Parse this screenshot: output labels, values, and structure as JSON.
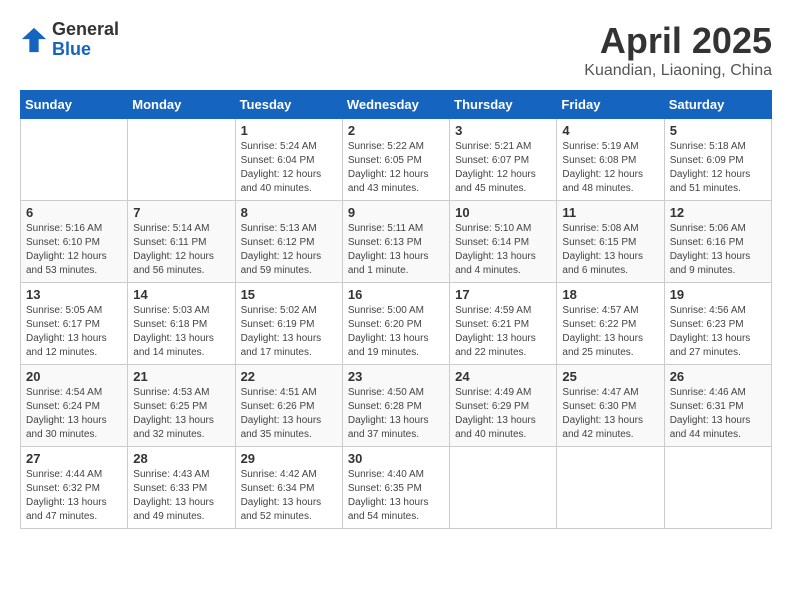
{
  "header": {
    "logo_general": "General",
    "logo_blue": "Blue",
    "month": "April 2025",
    "location": "Kuandian, Liaoning, China"
  },
  "weekdays": [
    "Sunday",
    "Monday",
    "Tuesday",
    "Wednesday",
    "Thursday",
    "Friday",
    "Saturday"
  ],
  "weeks": [
    [
      {
        "day": "",
        "sunrise": "",
        "sunset": "",
        "daylight": ""
      },
      {
        "day": "",
        "sunrise": "",
        "sunset": "",
        "daylight": ""
      },
      {
        "day": "1",
        "sunrise": "Sunrise: 5:24 AM",
        "sunset": "Sunset: 6:04 PM",
        "daylight": "Daylight: 12 hours and 40 minutes."
      },
      {
        "day": "2",
        "sunrise": "Sunrise: 5:22 AM",
        "sunset": "Sunset: 6:05 PM",
        "daylight": "Daylight: 12 hours and 43 minutes."
      },
      {
        "day": "3",
        "sunrise": "Sunrise: 5:21 AM",
        "sunset": "Sunset: 6:07 PM",
        "daylight": "Daylight: 12 hours and 45 minutes."
      },
      {
        "day": "4",
        "sunrise": "Sunrise: 5:19 AM",
        "sunset": "Sunset: 6:08 PM",
        "daylight": "Daylight: 12 hours and 48 minutes."
      },
      {
        "day": "5",
        "sunrise": "Sunrise: 5:18 AM",
        "sunset": "Sunset: 6:09 PM",
        "daylight": "Daylight: 12 hours and 51 minutes."
      }
    ],
    [
      {
        "day": "6",
        "sunrise": "Sunrise: 5:16 AM",
        "sunset": "Sunset: 6:10 PM",
        "daylight": "Daylight: 12 hours and 53 minutes."
      },
      {
        "day": "7",
        "sunrise": "Sunrise: 5:14 AM",
        "sunset": "Sunset: 6:11 PM",
        "daylight": "Daylight: 12 hours and 56 minutes."
      },
      {
        "day": "8",
        "sunrise": "Sunrise: 5:13 AM",
        "sunset": "Sunset: 6:12 PM",
        "daylight": "Daylight: 12 hours and 59 minutes."
      },
      {
        "day": "9",
        "sunrise": "Sunrise: 5:11 AM",
        "sunset": "Sunset: 6:13 PM",
        "daylight": "Daylight: 13 hours and 1 minute."
      },
      {
        "day": "10",
        "sunrise": "Sunrise: 5:10 AM",
        "sunset": "Sunset: 6:14 PM",
        "daylight": "Daylight: 13 hours and 4 minutes."
      },
      {
        "day": "11",
        "sunrise": "Sunrise: 5:08 AM",
        "sunset": "Sunset: 6:15 PM",
        "daylight": "Daylight: 13 hours and 6 minutes."
      },
      {
        "day": "12",
        "sunrise": "Sunrise: 5:06 AM",
        "sunset": "Sunset: 6:16 PM",
        "daylight": "Daylight: 13 hours and 9 minutes."
      }
    ],
    [
      {
        "day": "13",
        "sunrise": "Sunrise: 5:05 AM",
        "sunset": "Sunset: 6:17 PM",
        "daylight": "Daylight: 13 hours and 12 minutes."
      },
      {
        "day": "14",
        "sunrise": "Sunrise: 5:03 AM",
        "sunset": "Sunset: 6:18 PM",
        "daylight": "Daylight: 13 hours and 14 minutes."
      },
      {
        "day": "15",
        "sunrise": "Sunrise: 5:02 AM",
        "sunset": "Sunset: 6:19 PM",
        "daylight": "Daylight: 13 hours and 17 minutes."
      },
      {
        "day": "16",
        "sunrise": "Sunrise: 5:00 AM",
        "sunset": "Sunset: 6:20 PM",
        "daylight": "Daylight: 13 hours and 19 minutes."
      },
      {
        "day": "17",
        "sunrise": "Sunrise: 4:59 AM",
        "sunset": "Sunset: 6:21 PM",
        "daylight": "Daylight: 13 hours and 22 minutes."
      },
      {
        "day": "18",
        "sunrise": "Sunrise: 4:57 AM",
        "sunset": "Sunset: 6:22 PM",
        "daylight": "Daylight: 13 hours and 25 minutes."
      },
      {
        "day": "19",
        "sunrise": "Sunrise: 4:56 AM",
        "sunset": "Sunset: 6:23 PM",
        "daylight": "Daylight: 13 hours and 27 minutes."
      }
    ],
    [
      {
        "day": "20",
        "sunrise": "Sunrise: 4:54 AM",
        "sunset": "Sunset: 6:24 PM",
        "daylight": "Daylight: 13 hours and 30 minutes."
      },
      {
        "day": "21",
        "sunrise": "Sunrise: 4:53 AM",
        "sunset": "Sunset: 6:25 PM",
        "daylight": "Daylight: 13 hours and 32 minutes."
      },
      {
        "day": "22",
        "sunrise": "Sunrise: 4:51 AM",
        "sunset": "Sunset: 6:26 PM",
        "daylight": "Daylight: 13 hours and 35 minutes."
      },
      {
        "day": "23",
        "sunrise": "Sunrise: 4:50 AM",
        "sunset": "Sunset: 6:28 PM",
        "daylight": "Daylight: 13 hours and 37 minutes."
      },
      {
        "day": "24",
        "sunrise": "Sunrise: 4:49 AM",
        "sunset": "Sunset: 6:29 PM",
        "daylight": "Daylight: 13 hours and 40 minutes."
      },
      {
        "day": "25",
        "sunrise": "Sunrise: 4:47 AM",
        "sunset": "Sunset: 6:30 PM",
        "daylight": "Daylight: 13 hours and 42 minutes."
      },
      {
        "day": "26",
        "sunrise": "Sunrise: 4:46 AM",
        "sunset": "Sunset: 6:31 PM",
        "daylight": "Daylight: 13 hours and 44 minutes."
      }
    ],
    [
      {
        "day": "27",
        "sunrise": "Sunrise: 4:44 AM",
        "sunset": "Sunset: 6:32 PM",
        "daylight": "Daylight: 13 hours and 47 minutes."
      },
      {
        "day": "28",
        "sunrise": "Sunrise: 4:43 AM",
        "sunset": "Sunset: 6:33 PM",
        "daylight": "Daylight: 13 hours and 49 minutes."
      },
      {
        "day": "29",
        "sunrise": "Sunrise: 4:42 AM",
        "sunset": "Sunset: 6:34 PM",
        "daylight": "Daylight: 13 hours and 52 minutes."
      },
      {
        "day": "30",
        "sunrise": "Sunrise: 4:40 AM",
        "sunset": "Sunset: 6:35 PM",
        "daylight": "Daylight: 13 hours and 54 minutes."
      },
      {
        "day": "",
        "sunrise": "",
        "sunset": "",
        "daylight": ""
      },
      {
        "day": "",
        "sunrise": "",
        "sunset": "",
        "daylight": ""
      },
      {
        "day": "",
        "sunrise": "",
        "sunset": "",
        "daylight": ""
      }
    ]
  ]
}
